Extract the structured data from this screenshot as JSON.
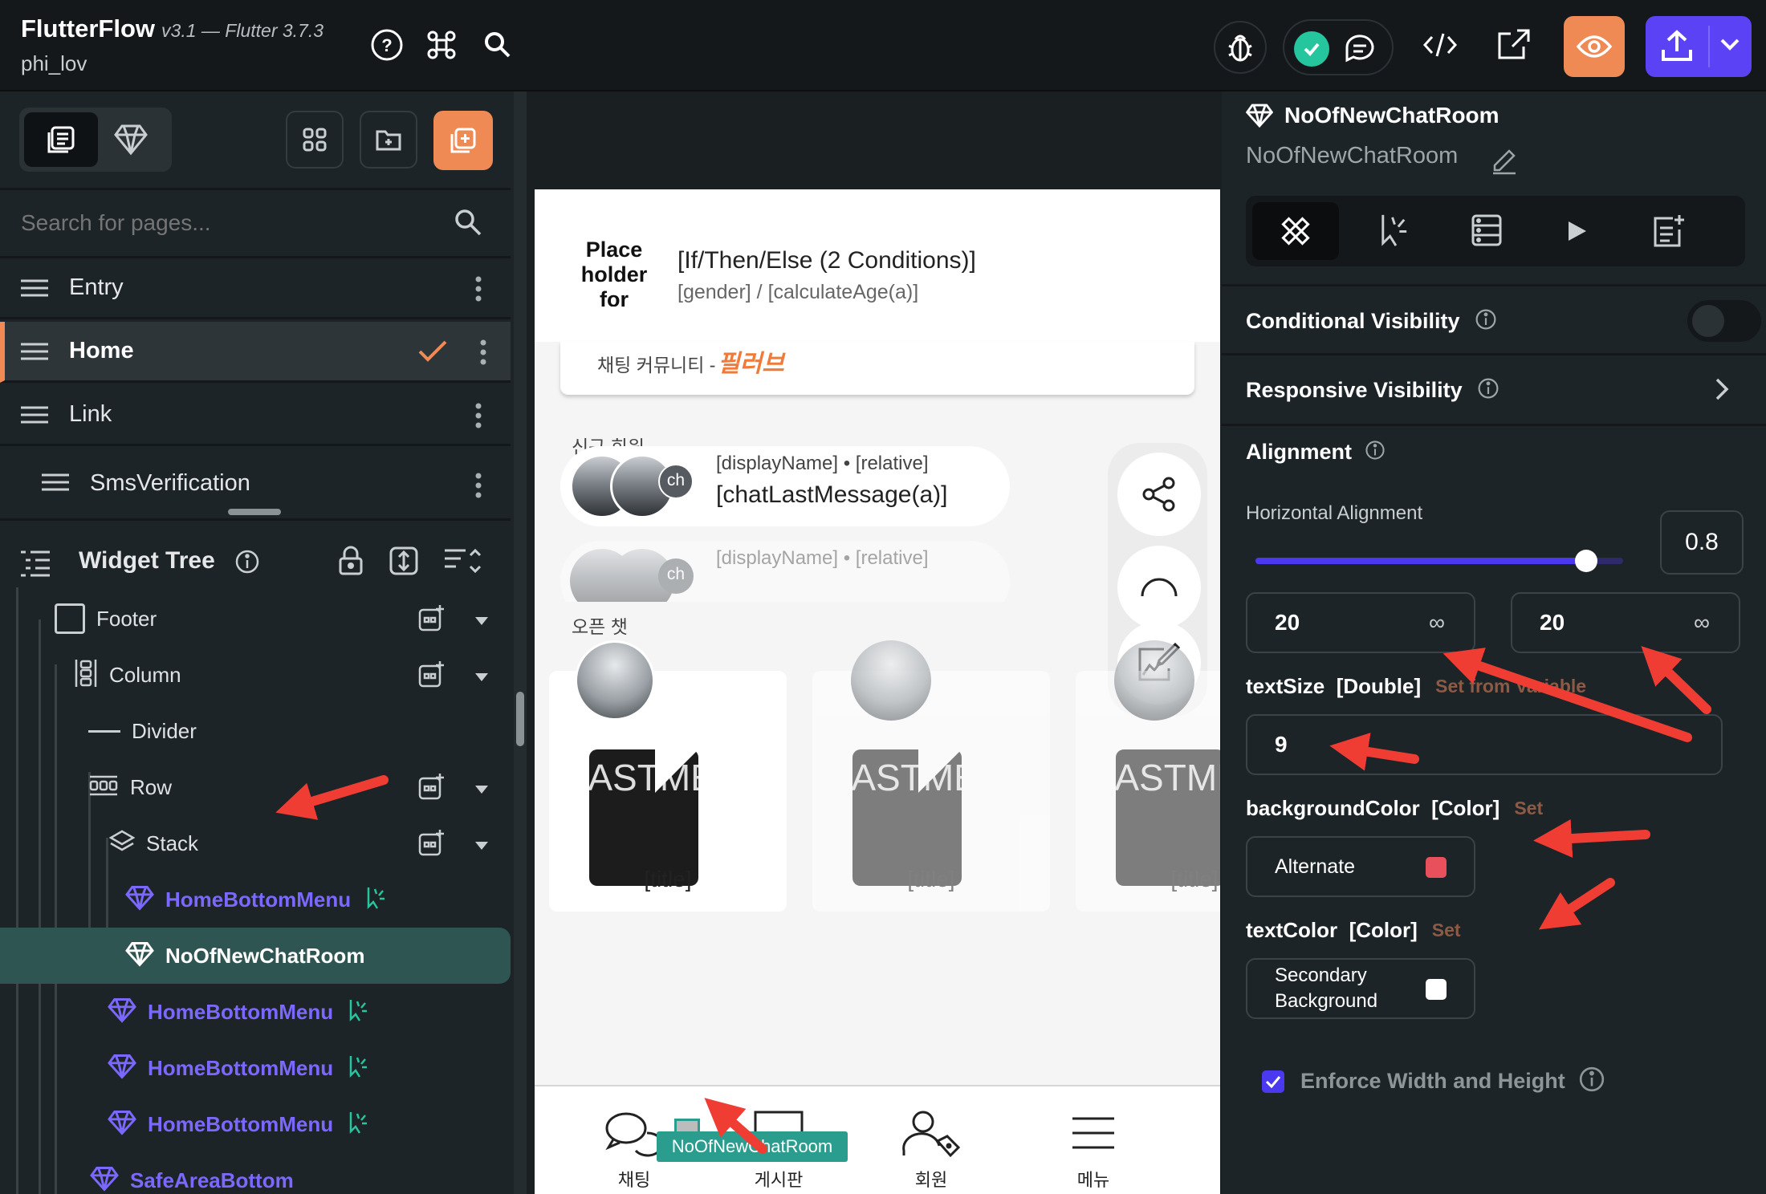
{
  "app": {
    "name": "FlutterFlow",
    "version": "v3.1 — Flutter 3.7.3",
    "project": "phi_lov"
  },
  "left": {
    "search_placeholder": "Search for pages...",
    "pages": [
      {
        "label": "Entry",
        "active": false
      },
      {
        "label": "Home",
        "active": true
      },
      {
        "label": "Link",
        "active": false
      },
      {
        "label": "SmsVerification",
        "active": false
      }
    ],
    "widget_tree_title": "Widget Tree",
    "tree": [
      {
        "label": "Footer",
        "indent": 0
      },
      {
        "label": "Column",
        "indent": 1
      },
      {
        "label": "Divider",
        "indent": 2
      },
      {
        "label": "Row",
        "indent": 2
      },
      {
        "label": "Stack",
        "indent": 3
      },
      {
        "label": "HomeBottomMenu",
        "indent": 4
      },
      {
        "label": "NoOfNewChatRoom",
        "indent": 4
      },
      {
        "label": "HomeBottomMenu",
        "indent": 3
      },
      {
        "label": "HomeBottomMenu",
        "indent": 3
      },
      {
        "label": "HomeBottomMenu",
        "indent": 3
      },
      {
        "label": "SafeAreaBottom",
        "indent": 2
      }
    ]
  },
  "canvas": {
    "placeholder_img": "Place holder for",
    "header_title": "[If/Then/Else (2 Conditions)]",
    "header_sub": "[gender] / [calculateAge(a)]",
    "community_text": "채팅 커뮤니티 -",
    "brand_text": "필러브",
    "section_new": "신규 회원",
    "chat_item_meta": "[displayName] • [relative]",
    "chat_item_msg": "[chatLastMessage(a)]",
    "avatar_ch": "ch",
    "open_chat_title": "오픈 챗",
    "card_bg_text": "[LASTMESSAGEUP",
    "card_title": "[title]",
    "selection_tag": "NoOfNewChatRoom",
    "bottom_nav": [
      "채팅",
      "게시판",
      "회원",
      "메뉴"
    ]
  },
  "right": {
    "widget_name": "NoOfNewChatRoom",
    "widget_subname": "NoOfNewChatRoom",
    "conditional_visibility": "Conditional Visibility",
    "responsive_visibility": "Responsive Visibility",
    "alignment": "Alignment",
    "horizontal_alignment": "Horizontal Alignment",
    "alignment_value": "0.8",
    "slider_fraction": 0.9,
    "width_value": "20",
    "height_value": "20",
    "infinity_symbol": "∞",
    "text_size_label": "textSize  [Double]",
    "set_from_variable": "Set from Variable",
    "text_size_value": "9",
    "bg_color_label": "backgroundColor  [Color]",
    "set_label": "Set",
    "bg_color_value": "Alternate",
    "bg_color_swatch": "#e8505b",
    "text_color_label": "textColor  [Color]",
    "text_color_value": "Secondary Background",
    "text_color_swatch": "#ffffff",
    "enforce_label": "Enforce Width and Height",
    "enforce_checked": true
  },
  "colors": {
    "accent_orange": "#ef8a54",
    "accent_purple": "#5b43f5",
    "selected_row": "#2f5552",
    "tag_teal": "#2a9d8f",
    "arrow_red": "#ef3d33",
    "slider": "#4b39ef"
  }
}
